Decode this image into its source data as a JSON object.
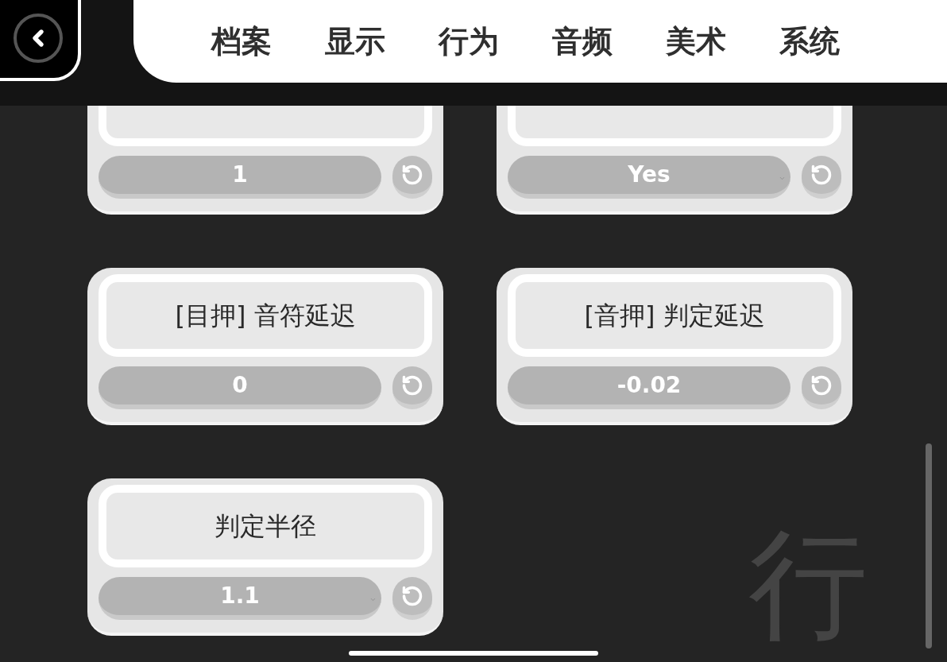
{
  "tabs": [
    {
      "label": "档案",
      "selected": false
    },
    {
      "label": "显示",
      "selected": false
    },
    {
      "label": "行为",
      "selected": false
    },
    {
      "label": "音频",
      "selected": false
    },
    {
      "label": "美术",
      "selected": false
    },
    {
      "label": "系统",
      "selected": false
    }
  ],
  "settings": [
    {
      "value": "1",
      "kind": "number"
    },
    {
      "value": "Yes",
      "kind": "dropdown"
    },
    {
      "title": "[目押] 音符延迟",
      "value": "0",
      "kind": "number"
    },
    {
      "title": "[音押] 判定延迟",
      "value": "-0.02",
      "kind": "number"
    },
    {
      "title": "判定半径",
      "value": "1.1",
      "kind": "dropdown"
    }
  ],
  "section_watermark": "行"
}
